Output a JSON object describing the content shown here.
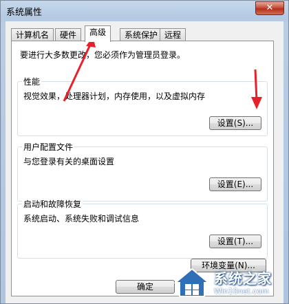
{
  "window": {
    "title": "系统属性",
    "close_glyph": "✕"
  },
  "tabs": [
    {
      "label": "计算机名",
      "active": false
    },
    {
      "label": "硬件",
      "active": false
    },
    {
      "label": "高级",
      "active": true
    },
    {
      "label": "系统保护",
      "active": false
    },
    {
      "label": "远程",
      "active": false
    }
  ],
  "notice": "要进行大多数更改，您必须作为管理员登录。",
  "groups": {
    "performance": {
      "title": "性能",
      "description": "视觉效果，处理器计划，内存使用，以及虚拟内存",
      "button": "设置(S)..."
    },
    "user_profiles": {
      "title": "用户配置文件",
      "description": "与您登录有关的桌面设置",
      "button": "设置(E)..."
    },
    "startup_recovery": {
      "title": "启动和故障恢复",
      "description": "系统启动、系统失败和调试信息",
      "button": "设置(T)..."
    }
  },
  "env_button": "环境变量(N)...",
  "ok_button": "确定",
  "watermark": {
    "main": "系统之家",
    "sub": "Win10net.com"
  },
  "colors": {
    "annotation_arrow": "#e8202a",
    "titlebar": "#b9cde4",
    "panel_border": "#8e8f8f"
  }
}
